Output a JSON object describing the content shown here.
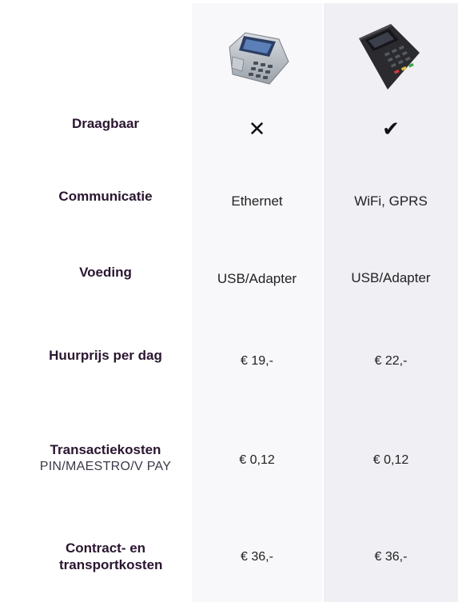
{
  "devices": [
    {
      "name": "countertop-pin-terminal"
    },
    {
      "name": "mobile-pin-terminal"
    }
  ],
  "rows": [
    {
      "label": "Draagbaar",
      "sub": "",
      "values": [
        "✕",
        "✔"
      ]
    },
    {
      "label": "Communicatie",
      "sub": "",
      "values": [
        "Ethernet",
        "WiFi, GPRS"
      ]
    },
    {
      "label": "Voeding",
      "sub": "",
      "values": [
        "USB/Adapter",
        "USB/Adapter"
      ]
    },
    {
      "label": "Huurprijs per dag",
      "sub": "",
      "values": [
        "€ 19,-",
        "€ 22,-"
      ]
    },
    {
      "label": "Transactiekosten",
      "sub": "PIN/MAESTRO/V PAY",
      "values": [
        "€ 0,12",
        "€ 0,12"
      ]
    },
    {
      "label": "Contract- en transportkosten",
      "sub": "",
      "values": [
        "€ 36,-",
        "€ 36,-"
      ]
    }
  ]
}
